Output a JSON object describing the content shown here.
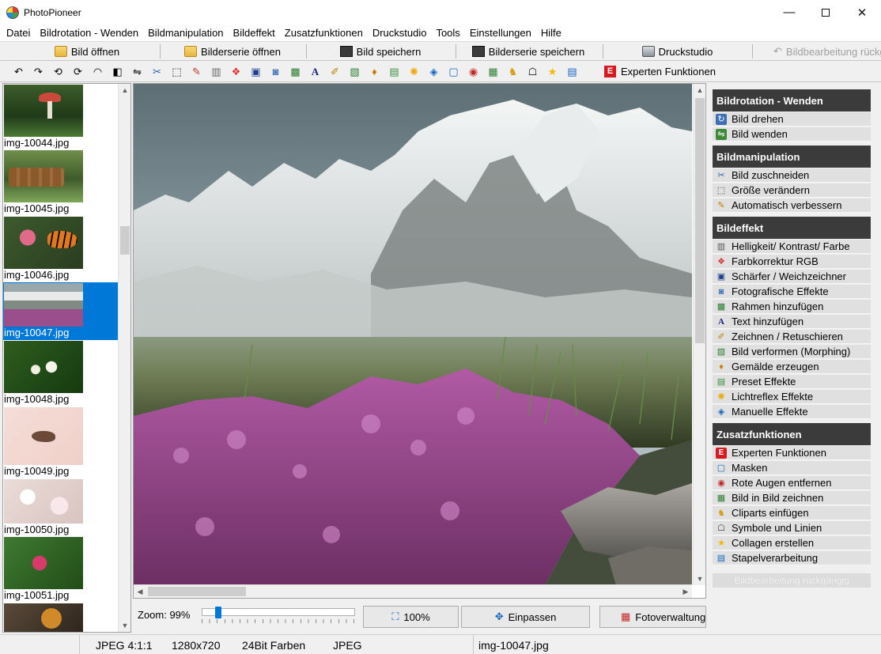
{
  "window": {
    "title": "PhotoPioneer"
  },
  "menu": [
    "Datei",
    "Bildrotation - Wenden",
    "Bildmanipulation",
    "Bildeffekt",
    "Zusatzfunktionen",
    "Druckstudio",
    "Tools",
    "Einstellungen",
    "Hilfe"
  ],
  "toolbar": {
    "open": "Bild öffnen",
    "open_series": "Bilderserie öffnen",
    "save": "Bild speichern",
    "save_series": "Bilderserie speichern",
    "print": "Druckstudio",
    "undo": "Bildbearbeitung rückgängig"
  },
  "toolbar2": {
    "expert": "Experten Funktionen"
  },
  "thumbnails": [
    {
      "label": "img-10044.jpg"
    },
    {
      "label": "img-10045.jpg"
    },
    {
      "label": "img-10046.jpg"
    },
    {
      "label": "img-10047.jpg",
      "selected": true
    },
    {
      "label": "img-10048.jpg"
    },
    {
      "label": "img-10049.jpg"
    },
    {
      "label": "img-10050.jpg"
    },
    {
      "label": "img-10051.jpg"
    }
  ],
  "zoom": {
    "label": "Zoom: 99%",
    "value_pct": 99,
    "btn_100": "100%",
    "btn_fit": "Einpassen",
    "btn_manage": "Fotoverwaltung"
  },
  "panel": {
    "sections": [
      {
        "title": "Bildrotation - Wenden",
        "items": [
          "Bild drehen",
          "Bild wenden"
        ]
      },
      {
        "title": "Bildmanipulation",
        "items": [
          "Bild zuschneiden",
          "Größe verändern",
          "Automatisch verbessern"
        ]
      },
      {
        "title": "Bildeffekt",
        "items": [
          "Helligkeit/ Kontrast/ Farbe",
          "Farbkorrektur RGB",
          "Schärfer / Weichzeichner",
          "Fotografische Effekte",
          "Rahmen hinzufügen",
          "Text hinzufügen",
          "Zeichnen / Retuschieren",
          "Bild verformen (Morphing)",
          "Gemälde erzeugen",
          "Preset Effekte",
          "Lichtreflex Effekte",
          "Manuelle Effekte"
        ]
      },
      {
        "title": "Zusatzfunktionen",
        "items": [
          "Experten Funktionen",
          "Masken",
          "Rote Augen entfernen",
          "Bild in Bild zeichnen",
          "Cliparts einfügen",
          "Symbole und Linien",
          "Collagen erstellen",
          "Stapelverarbeitung"
        ]
      }
    ],
    "undo": "Bildbearbeitung rückgängig"
  },
  "status": {
    "format": "JPEG  4:1:1",
    "size": "1280x720",
    "colors": "24Bit Farben",
    "type": "JPEG",
    "file": "img-10047.jpg"
  }
}
